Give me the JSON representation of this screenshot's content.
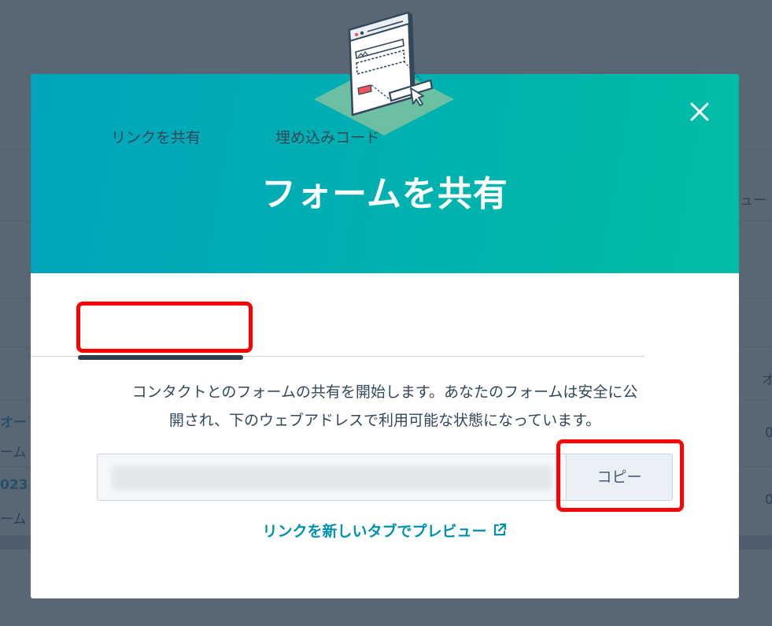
{
  "background": {
    "fragments": [
      "ュー",
      "オー",
      "ーム",
      "023",
      "ーム",
      "オ",
      "0",
      "0"
    ]
  },
  "modal": {
    "title": "フォームを共有",
    "close_icon": "close-icon",
    "illustration_icon": "form-share-illustration",
    "tabs": [
      {
        "label": "リンクを共有",
        "active": true
      },
      {
        "label": "埋め込みコード",
        "active": false
      }
    ],
    "description_line1": "コンタクトとのフォームの共有を開始します。あなたのフォームは安全に公",
    "description_line2": "開され、下のウェブアドレスで利用可能な状態になっています。",
    "url_value": "",
    "copy_label": "コピー",
    "preview_link": "リンクを新しいタブでプレビュー",
    "preview_icon": "external-link-icon"
  },
  "colors": {
    "header_start": "#00a4bd",
    "header_end": "#00bda5",
    "link": "#0091ae",
    "annotation": "#ff0000"
  }
}
